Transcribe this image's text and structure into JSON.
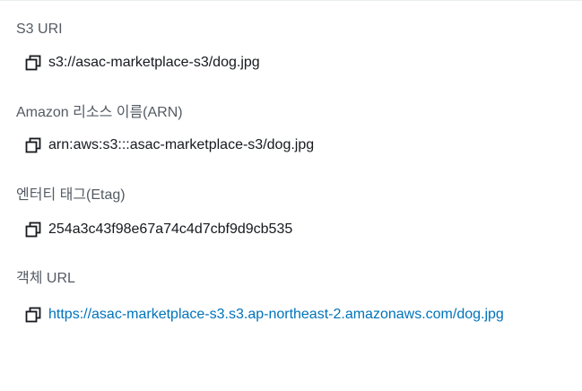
{
  "fields": [
    {
      "label": "S3 URI",
      "value": "s3://asac-marketplace-s3/dog.jpg",
      "copy_icon": "copy-icon"
    },
    {
      "label": "Amazon 리소스 이름(ARN)",
      "value": "arn:aws:s3:::asac-marketplace-s3/dog.jpg",
      "copy_icon": "copy-icon"
    },
    {
      "label": "엔터티 태그(Etag)",
      "value": "254a3c43f98e67a74c4d7cbf9d9cb535",
      "copy_icon": "copy-icon"
    },
    {
      "label": "객체 URL",
      "value": "https://asac-marketplace-s3.s3.ap-northeast-2.amazonaws.com/dog.jpg",
      "copy_icon": "copy-icon"
    }
  ],
  "colors": {
    "label": "#545b64",
    "value": "#16191f",
    "link": "#0073bb",
    "icon": "#16191f"
  }
}
